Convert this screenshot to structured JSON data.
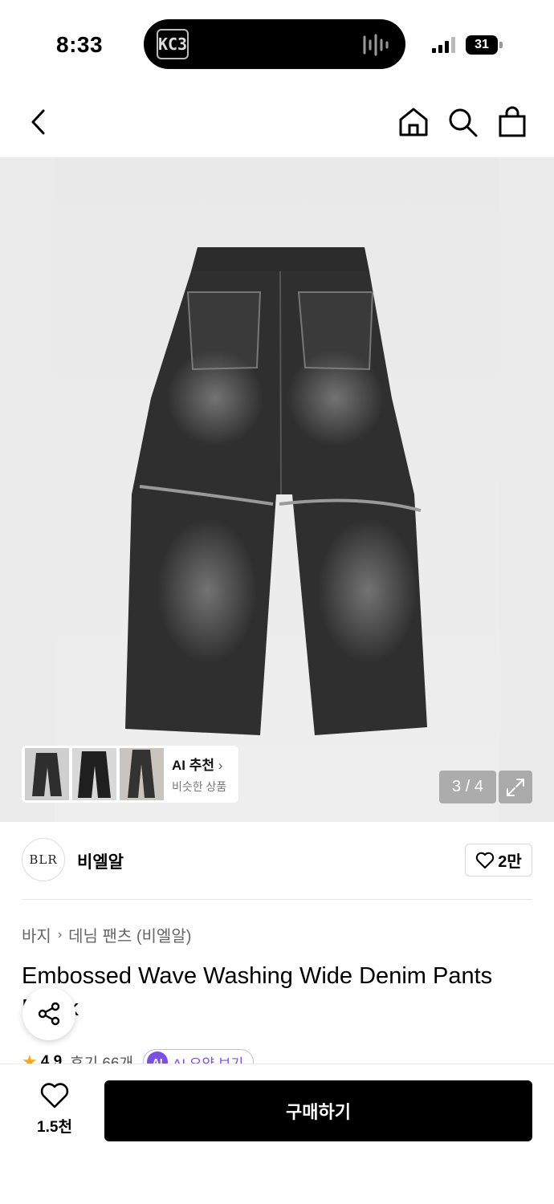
{
  "status": {
    "time": "8:33",
    "battery": "31",
    "island_logo": "KC3"
  },
  "hero": {
    "ai_card": {
      "title": "AI 추천",
      "subtitle": "비슷한 상품"
    },
    "counter": "3 / 4"
  },
  "brand": {
    "logo_text": "BLR",
    "name": "비엘알",
    "likes": "2만"
  },
  "product": {
    "breadcrumb": [
      "바지",
      "데님 팬츠 (비엘알)"
    ],
    "title": "Embossed Wave Washing Wide Denim Pants Black",
    "rating": "4.9",
    "reviews": "후기 66개",
    "ai_summary": "AI 요약 보기",
    "ai_badge": "AI"
  },
  "bottom": {
    "wish_count": "1.5천",
    "buy_label": "구매하기"
  },
  "colors": {
    "accent_purple": "#7b4fe0",
    "star": "#f6a623",
    "buy_button": "#000000"
  },
  "icons": [
    "back-icon",
    "home-icon",
    "search-icon",
    "bag-icon",
    "expand-icon",
    "heart-icon",
    "share-icon",
    "star-icon",
    "chevron-right-icon"
  ]
}
